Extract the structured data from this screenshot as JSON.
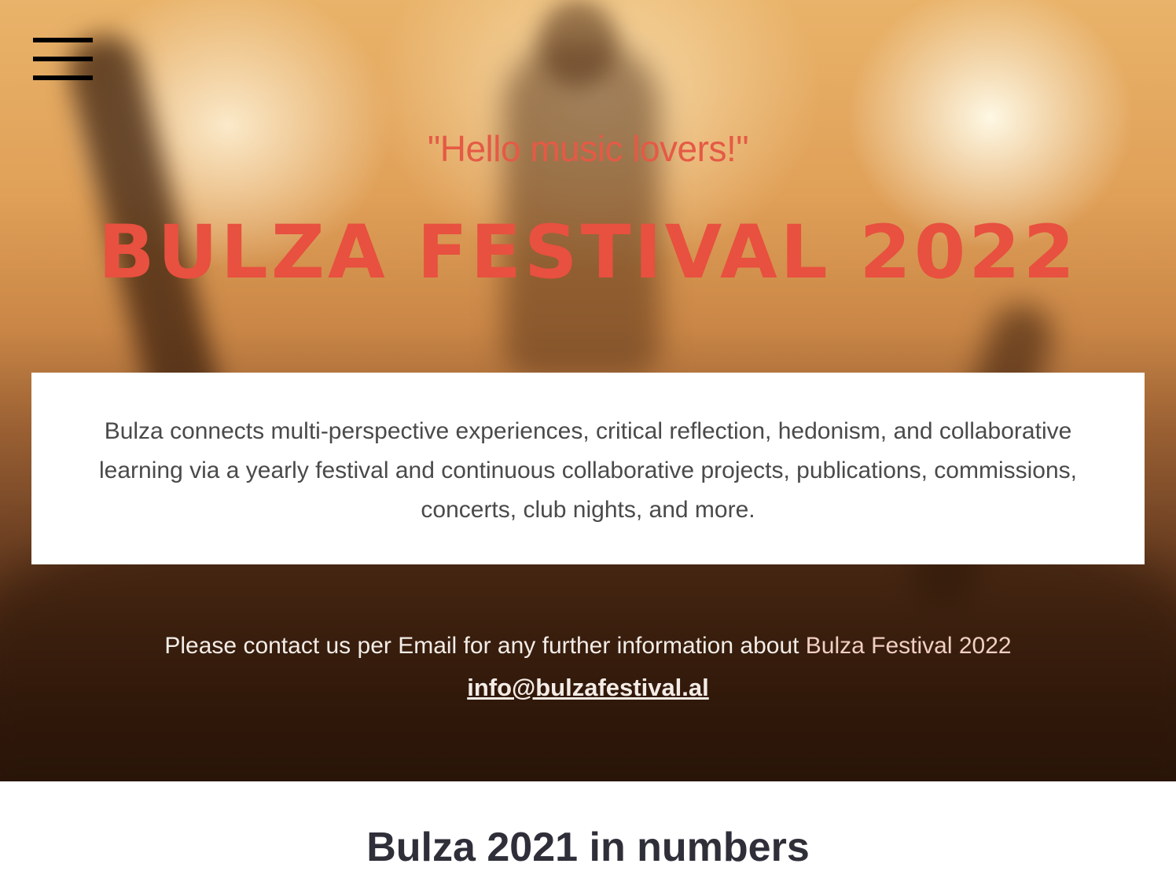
{
  "nav": {
    "menu_icon": "hamburger-menu-icon"
  },
  "hero": {
    "tagline": "\"Hello music lovers!\"",
    "title": "BULZA FESTIVAL 2022"
  },
  "about": {
    "text": "Bulza connects multi-perspective experiences, critical reflection, hedonism, and collaborative learning via a yearly festival and continuous collaborative projects, publications, commissions, concerts, club nights, and more."
  },
  "contact": {
    "text": "Please contact us per Email for any further information about ",
    "highlight": "Bulza Festival 2022",
    "email": "info@bulzafestival.al"
  },
  "next_section": {
    "heading": "Bulza 2021 in numbers"
  },
  "colors": {
    "accent": "#e8503f",
    "hero_text": "#f3ede8"
  }
}
